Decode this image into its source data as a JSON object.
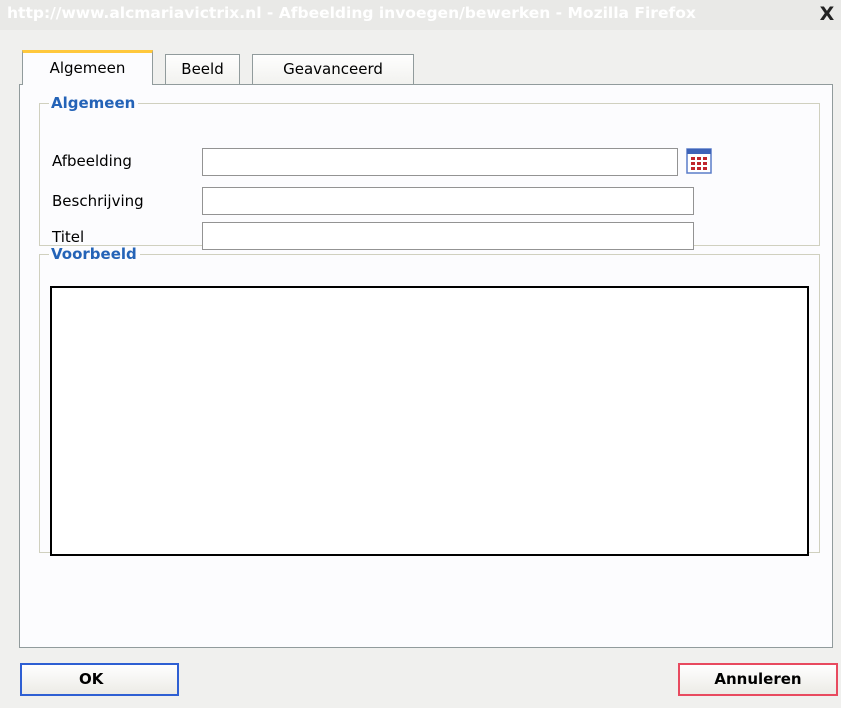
{
  "window": {
    "title": "http://www.alcmariavictrix.nl - Afbeelding invoegen/bewerken - Mozilla Firefox",
    "close_label": "X"
  },
  "tabs": [
    {
      "label": "Algemeen",
      "active": true
    },
    {
      "label": "Beeld",
      "active": false
    },
    {
      "label": "Geavanceerd",
      "active": false
    }
  ],
  "general": {
    "legend": "Algemeen",
    "fields": [
      {
        "label": "Afbeelding",
        "value": ""
      },
      {
        "label": "Beschrijving",
        "value": ""
      },
      {
        "label": "Titel",
        "value": ""
      }
    ],
    "browse_icon": "browse-icon"
  },
  "preview": {
    "legend": "Voorbeeld"
  },
  "buttons": {
    "ok": "OK",
    "cancel": "Annuleren"
  },
  "colors": {
    "legend": "#2463b7",
    "active_tab_accent": "#ffc83c",
    "ok_border": "#2e5fd3",
    "cancel_border": "#e84a5f"
  }
}
